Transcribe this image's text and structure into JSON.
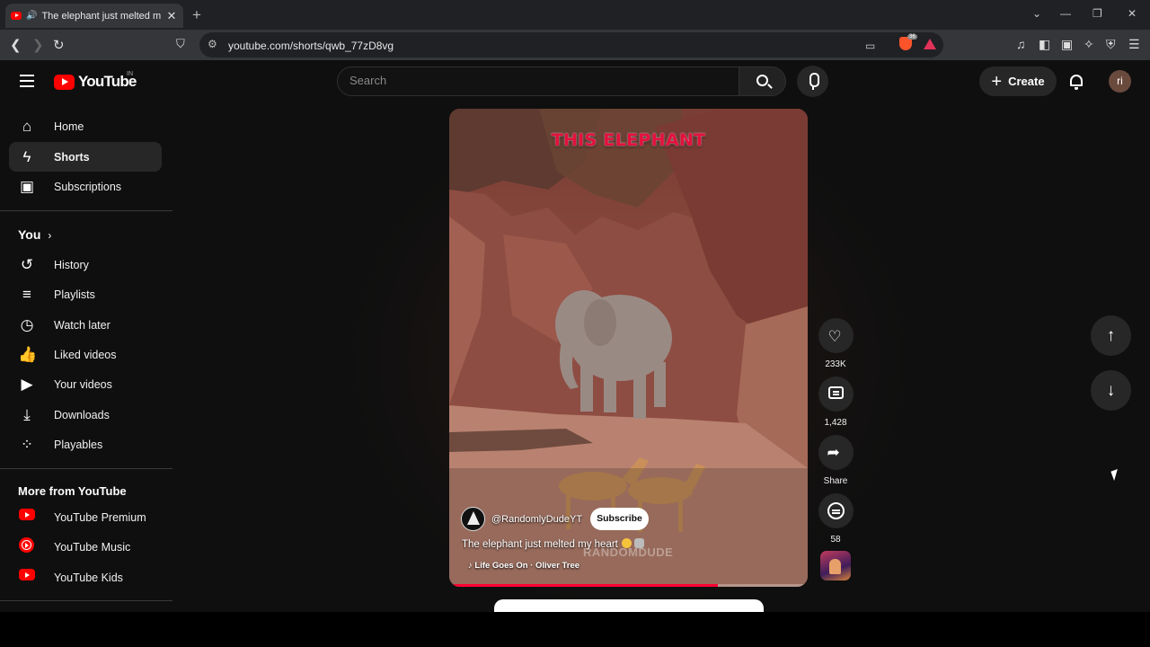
{
  "browser": {
    "tab_title": "The elephant just melted my heart",
    "tab_close": "✕",
    "new_tab": "+",
    "url": "youtube.com/shorts/qwb_77zD8vg",
    "brave_count": "36"
  },
  "header": {
    "logo_text": "YouTube",
    "country_code": "IN",
    "search_placeholder": "Search",
    "create_label": "Create",
    "avatar_initials": "ri"
  },
  "sidebar": {
    "main": [
      {
        "label": "Home",
        "icon": "home-icon"
      },
      {
        "label": "Shorts",
        "icon": "shorts-icon",
        "active": true
      },
      {
        "label": "Subscriptions",
        "icon": "subscriptions-icon"
      }
    ],
    "you_heading": "You",
    "you_items": [
      {
        "label": "History",
        "icon": "history-icon"
      },
      {
        "label": "Playlists",
        "icon": "playlists-icon"
      },
      {
        "label": "Watch later",
        "icon": "watch-later-icon"
      },
      {
        "label": "Liked videos",
        "icon": "liked-videos-icon"
      },
      {
        "label": "Your videos",
        "icon": "your-videos-icon"
      },
      {
        "label": "Downloads",
        "icon": "downloads-icon"
      },
      {
        "label": "Playables",
        "icon": "playables-icon"
      }
    ],
    "more_heading": "More from YouTube",
    "more_items": [
      {
        "label": "YouTube Premium",
        "icon": "youtube-premium-icon"
      },
      {
        "label": "YouTube Music",
        "icon": "youtube-music-icon"
      },
      {
        "label": "YouTube Kids",
        "icon": "youtube-kids-icon"
      }
    ]
  },
  "short": {
    "overlay_caption": "THIS ELEPHANT",
    "channel_handle": "@RandomlyDudeYT",
    "subscribe_label": "Subscribe",
    "title": "The elephant just melted my heart",
    "watermark": "RANDOMDUDE",
    "song": "Life Goes On · Oliver Tree",
    "progress_fraction": 0.75
  },
  "actions": {
    "likes": "233K",
    "comments": "1,428",
    "share_label": "Share",
    "remix_count": "58"
  },
  "colors": {
    "accent": "#ff0000",
    "background": "#0f0f0f",
    "progress": "#ff0033"
  }
}
